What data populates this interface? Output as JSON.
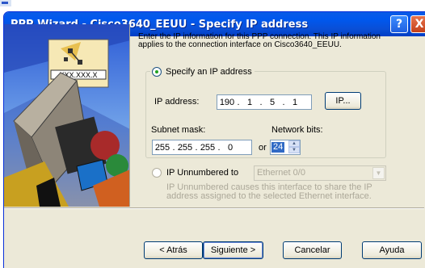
{
  "window": {
    "title": "PPP Wizard - Cisco3640_EEUU - Specify IP address",
    "help_glyph": "?",
    "close_glyph": "X"
  },
  "illustration": {
    "address_text": "XXX.XXX.X"
  },
  "description": "Enter the IP information for this PPP connection. This IP information applies to the connection interface on Cisco3640_EEUU.",
  "specify": {
    "radio_label": "Specify an IP address",
    "selected": true,
    "ip_label": "IP address:",
    "ip_octets": [
      "190",
      "1",
      "5",
      "1"
    ],
    "ip_button_label": "IP...",
    "mask_label": "Subnet mask:",
    "mask_octets": [
      "255",
      "255",
      "255",
      "0"
    ],
    "or_label": "or",
    "bits_label": "Network bits:",
    "bits_value": "24"
  },
  "unnumbered": {
    "radio_label": "IP Unnumbered to",
    "selected": false,
    "interface_value": "Ethernet 0/0",
    "note": "IP Unnumbered causes this interface to share the IP address assigned to the selected Ethernet interface."
  },
  "buttons": {
    "back": "< Atrás",
    "next": "Siguiente >",
    "cancel": "Cancelar",
    "help": "Ayuda"
  },
  "colors": {
    "titlebar": "#0a4fd6",
    "dialog_bg": "#ece9d8",
    "selection": "#316ac5",
    "disabled_text": "#aca899"
  }
}
